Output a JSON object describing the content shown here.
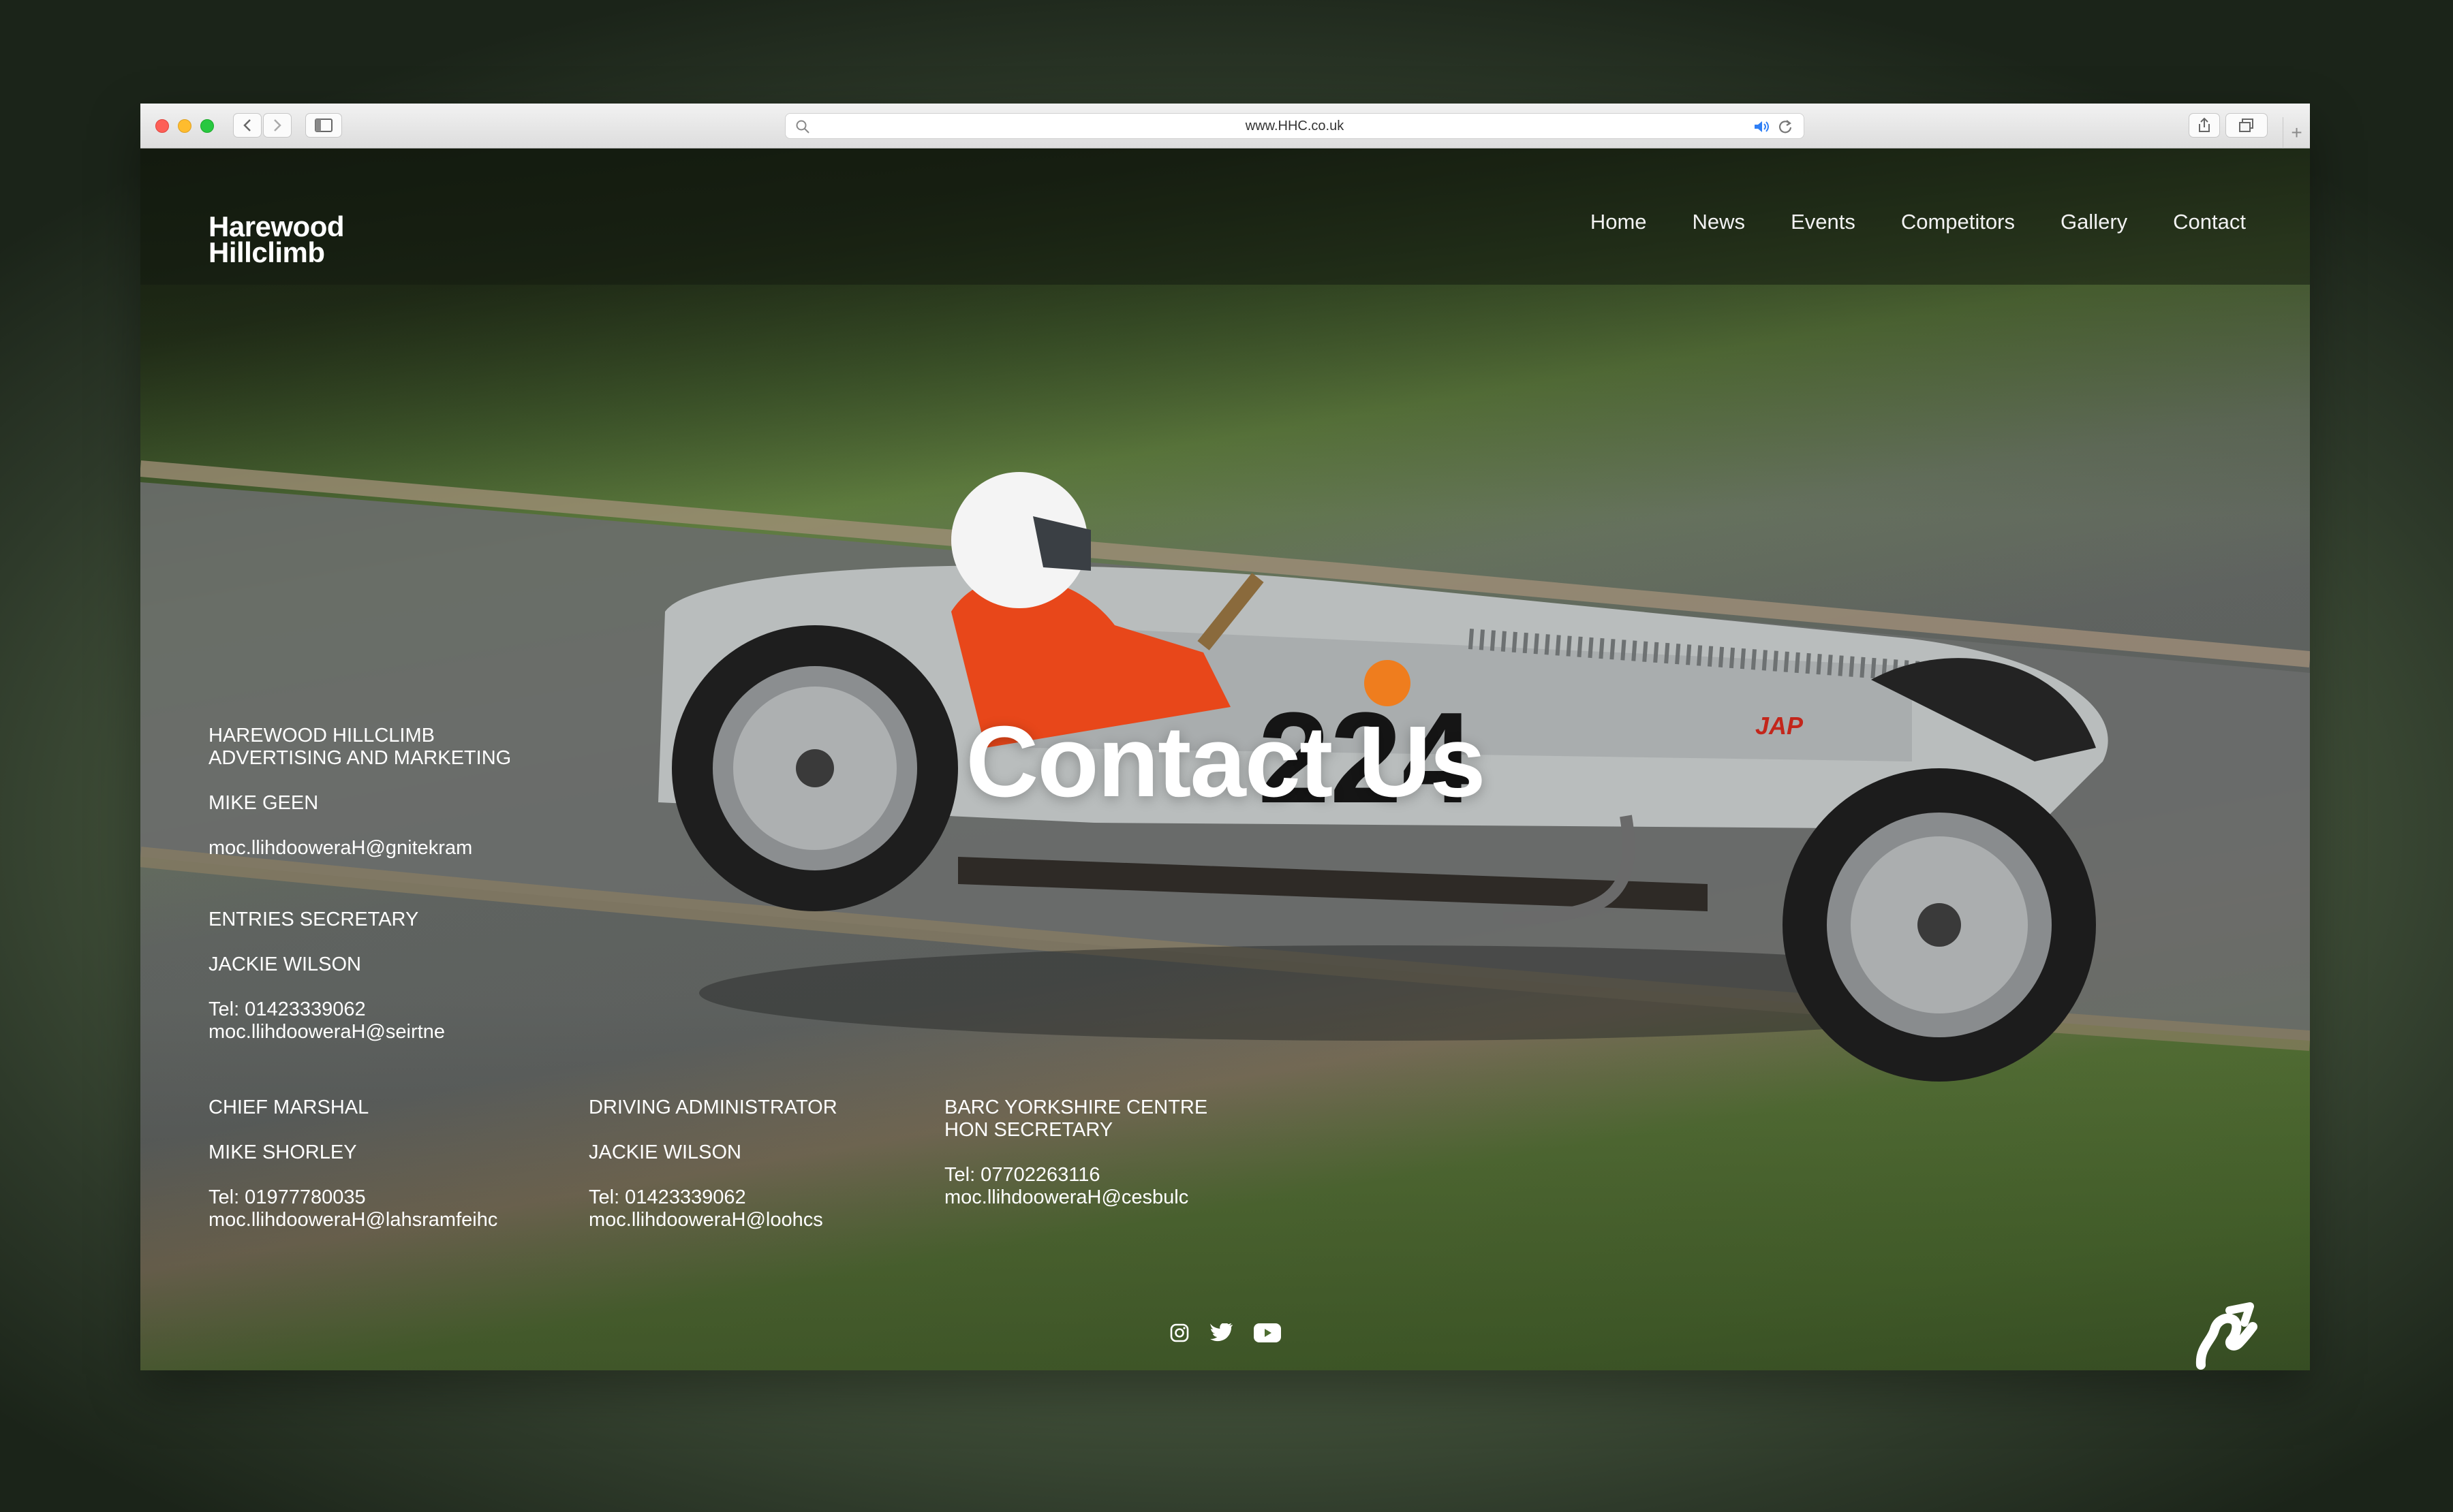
{
  "browser": {
    "url": "www.HHC.co.uk"
  },
  "site": {
    "logo_line1": "Harewood",
    "logo_line2": "Hillclimb",
    "nav": [
      "Home",
      "News",
      "Events",
      "Competitors",
      "Gallery",
      "Contact"
    ],
    "heading": "Contact Us"
  },
  "contacts": {
    "advertising": {
      "role_line1": "HAREWOOD HILLCLIMB",
      "role_line2": "ADVERTISING AND MARKETING",
      "name": "MIKE GEEN",
      "email": "moc.llihdooweraH@gnitekram"
    },
    "entries": {
      "role": "ENTRIES SECRETARY",
      "name": "JACKIE WILSON",
      "tel": "Tel: 01423339062",
      "email": "moc.llihdooweraH@seirtne"
    },
    "marshal": {
      "role": "CHIEF MARSHAL",
      "name": "MIKE SHORLEY",
      "tel": "Tel: 01977780035",
      "email": "moc.llihdooweraH@lahsramfeihc"
    },
    "driving": {
      "role": "DRIVING ADMINISTRATOR",
      "name": "JACKIE WILSON",
      "tel": "Tel: 01423339062",
      "email": "moc.llihdooweraH@loohcs"
    },
    "barc": {
      "role_line1": "BARC YORKSHIRE CENTRE",
      "role_line2": "HON SECRETARY",
      "tel": "Tel: 07702263116",
      "email": "moc.llihdooweraH@cesbulc"
    }
  },
  "social_icons": [
    "instagram-icon",
    "twitter-icon",
    "youtube-icon"
  ],
  "car_number": "224",
  "car_badge": "JAP"
}
